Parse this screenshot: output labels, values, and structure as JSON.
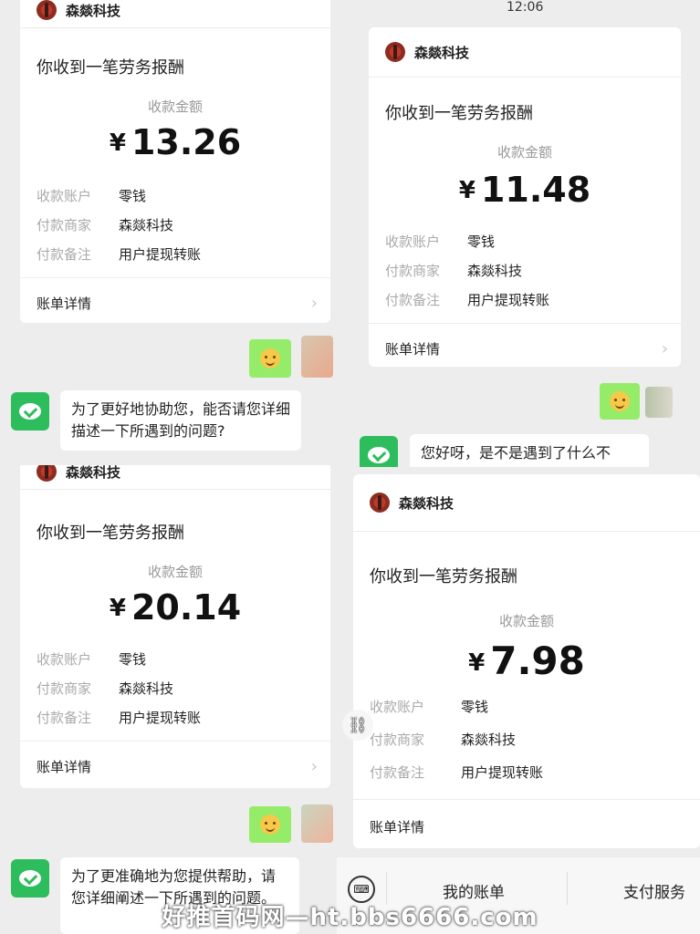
{
  "cards": [
    {
      "merchant": "森燚科技",
      "headline": "你收到一笔劳务报酬",
      "amount_label": "收款金额",
      "currency": "¥",
      "amount": "13.26",
      "rows": [
        {
          "k": "收款账户",
          "v": "零钱"
        },
        {
          "k": "付款商家",
          "v": "森燚科技"
        },
        {
          "k": "付款备注",
          "v": "用户提现转账"
        }
      ],
      "detail": "账单详情",
      "chevron": "›"
    },
    {
      "merchant": "森燚科技",
      "headline": "你收到一笔劳务报酬",
      "amount_label": "收款金额",
      "currency": "¥",
      "amount": "11.48",
      "rows": [
        {
          "k": "收款账户",
          "v": "零钱"
        },
        {
          "k": "付款商家",
          "v": "森燚科技"
        },
        {
          "k": "付款备注",
          "v": "用户提现转账"
        }
      ],
      "detail": "账单详情",
      "chevron": "›"
    },
    {
      "merchant": "森燚科技",
      "headline": "你收到一笔劳务报酬",
      "amount_label": "收款金额",
      "currency": "¥",
      "amount": "20.14",
      "rows": [
        {
          "k": "收款账户",
          "v": "零钱"
        },
        {
          "k": "付款商家",
          "v": "森燚科技"
        },
        {
          "k": "付款备注",
          "v": "用户提现转账"
        }
      ],
      "detail": "账单详情",
      "chevron": "›"
    },
    {
      "merchant": "森燚科技",
      "headline": "你收到一笔劳务报酬",
      "amount_label": "收款金额",
      "currency": "¥",
      "amount": "7.98",
      "rows": [
        {
          "k": "收款账户",
          "v": "零钱"
        },
        {
          "k": "付款商家",
          "v": "森燚科技"
        },
        {
          "k": "付款备注",
          "v": "用户提现转账"
        }
      ],
      "detail": "账单详情",
      "chevron": "›"
    }
  ],
  "messages": {
    "m1": "为了更好地协助您，能否请您详细描述一下所遇到的问题?",
    "m2": "您好呀，是不是遇到了什么不",
    "m3": "为了更准确地为您提供帮助，请您详细阐述一下所遇到的问题。"
  },
  "time": "12:06",
  "bottom_bar": {
    "my_bill": "我的账单",
    "pay_service": "支付服务"
  },
  "watermark": "好推首码网—ht.bbs6666.com",
  "colors": {
    "wechat_green": "#2ebd5c",
    "bubble_green": "#95ec69",
    "background": "#ededed"
  }
}
